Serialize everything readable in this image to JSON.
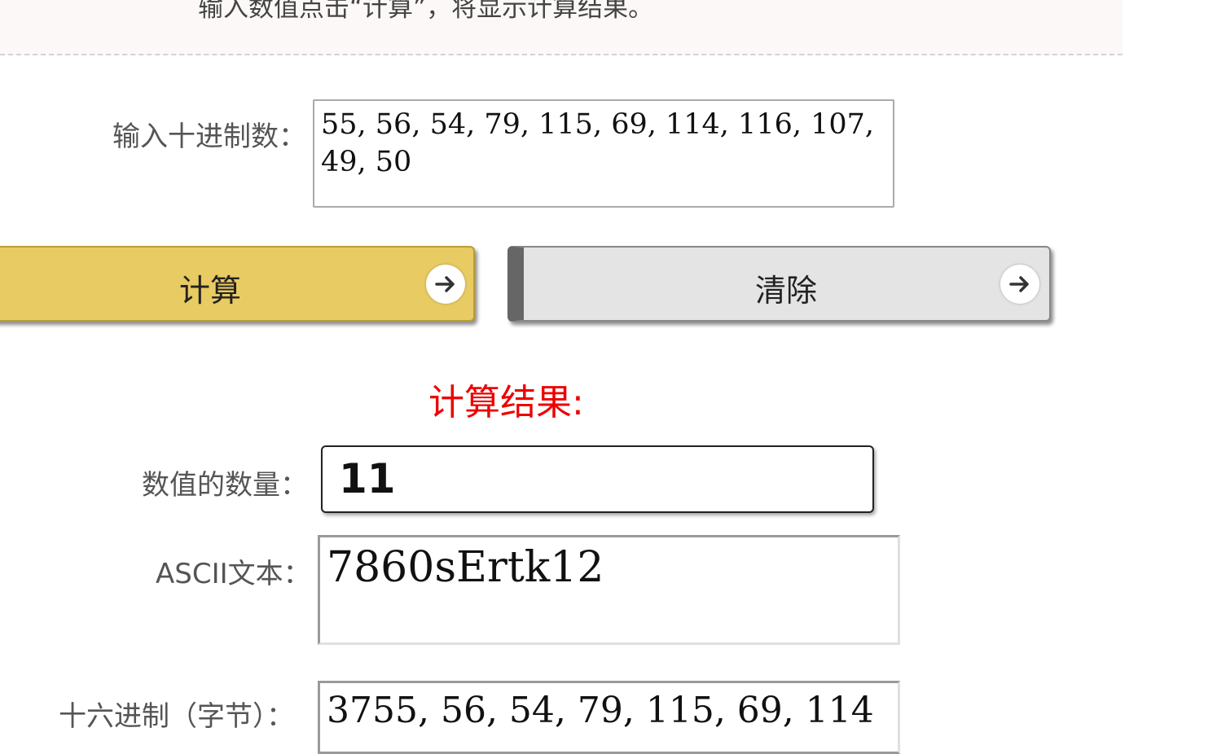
{
  "instructions": "输入数值点击“计算”，将显示计算结果。",
  "input": {
    "label": "输入十进制数：",
    "value": "55, 56, 54, 79, 115, 69, 114, 116, 107, 49, 50"
  },
  "buttons": {
    "calculate": "计算",
    "clear": "清除",
    "arrow_icon": "arrow-right-icon"
  },
  "result": {
    "title": "计算结果:",
    "count_label": "数值的数量：",
    "count_value": "11",
    "ascii_label": "ASCII文本：",
    "ascii_value": "7860sErtk12",
    "hex_label": "十六进制（字节）：",
    "hex_value": "3755, 56, 54, 79, 115, 69, 114"
  },
  "colors": {
    "calc_button": "#e8cb62",
    "clear_button": "#e4e4e4",
    "result_title": "#ee0000"
  }
}
